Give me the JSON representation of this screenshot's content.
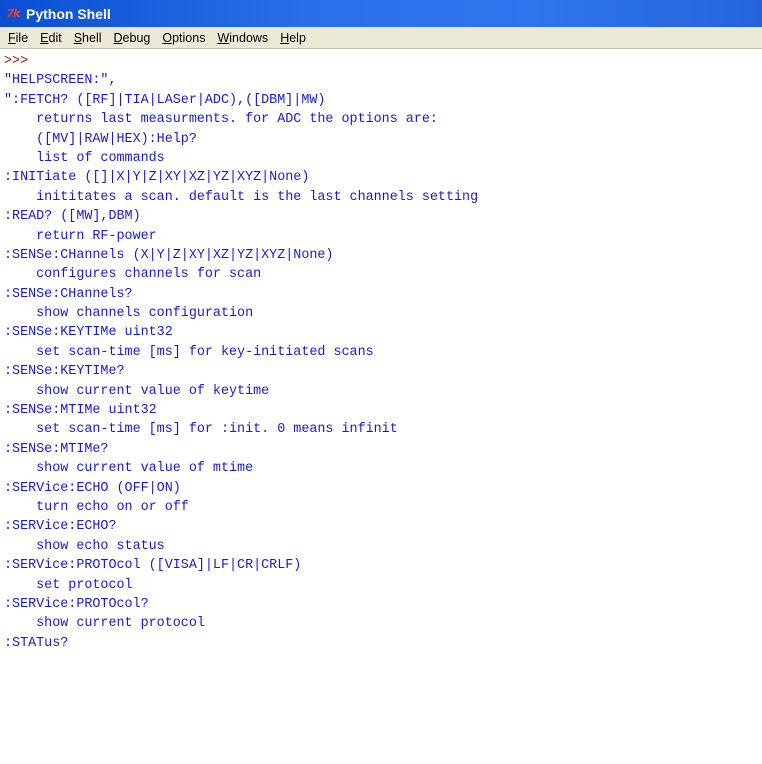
{
  "window": {
    "title": "Python Shell",
    "icon": "tk-icon"
  },
  "menubar": [
    {
      "first": "F",
      "rest": "ile"
    },
    {
      "first": "E",
      "rest": "dit"
    },
    {
      "first": "S",
      "rest": "hell"
    },
    {
      "first": "D",
      "rest": "ebug"
    },
    {
      "first": "O",
      "rest": "ptions"
    },
    {
      "first": "W",
      "rest": "indows"
    },
    {
      "first": "H",
      "rest": "elp"
    }
  ],
  "colors": {
    "prompt": "#a01010",
    "output": "#1a1acd",
    "menubar_bg": "#ece9d8"
  },
  "shell": {
    "prompt": ">>>",
    "lines": [
      "\"HELPSCREEN:\",",
      "\":FETCH? ([RF]|TIA|LASer|ADC),([DBM]|MW)",
      "    returns last measurments. for ADC the options are:",
      "    ([MV]|RAW|HEX):Help?",
      "    list of commands",
      ":INITiate ([]|X|Y|Z|XY|XZ|YZ|XYZ|None)",
      "    inititates a scan. default is the last channels setting",
      ":READ? ([MW],DBM)",
      "    return RF-power",
      ":SENSe:CHannels (X|Y|Z|XY|XZ|YZ|XYZ|None)",
      "    configures channels for scan",
      ":SENSe:CHannels?",
      "    show channels configuration",
      ":SENSe:KEYTIMe uint32",
      "    set scan-time [ms] for key-initiated scans",
      ":SENSe:KEYTIMe?",
      "    show current value of keytime",
      ":SENSe:MTIMe uint32",
      "    set scan-time [ms] for :init. 0 means infinit",
      ":SENSe:MTIMe?",
      "    show current value of mtime",
      ":SERVice:ECHO (OFF|ON)",
      "    turn echo on or off",
      ":SERVice:ECHO?",
      "    show echo status",
      ":SERVice:PROTOcol ([VISA]|LF|CR|CRLF)",
      "    set protocol",
      ":SERVice:PROTOcol?",
      "    show current protocol",
      ":STATus?"
    ]
  }
}
